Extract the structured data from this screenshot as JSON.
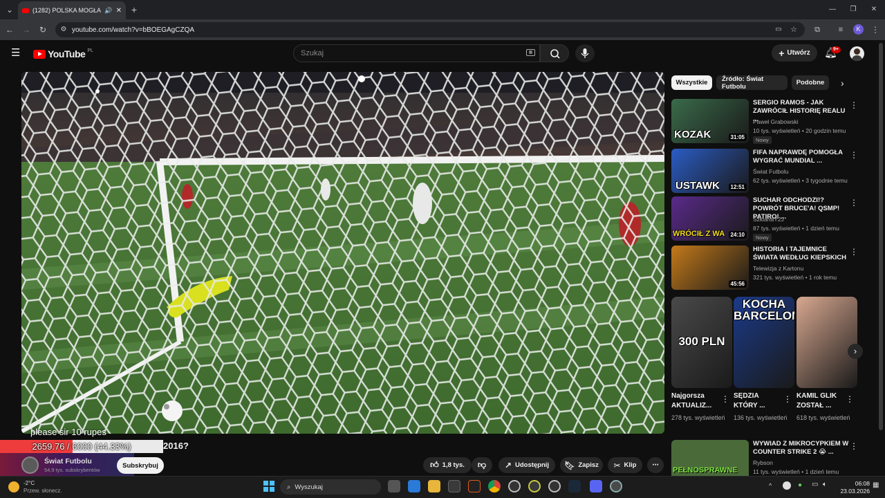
{
  "browser": {
    "tab_title": "(1282) POLSKA MOGŁA WY",
    "url": "youtube.com/watch?v=bBOEGAgCZQA"
  },
  "header": {
    "logo_text": "YouTube",
    "region": "PL",
    "search_placeholder": "Szukaj",
    "create_label": "Utwórz",
    "notif_count": "9+",
    "profile_initial": "K"
  },
  "player": {
    "overlay_text": "please sir 10 rupes",
    "progress_text": "2659.76 / 6000 (44.33%)",
    "progress_fraction": 0.4433,
    "title_fragment": "2016?"
  },
  "channel": {
    "name": "Świat Futbolu",
    "subs": "54,9 tys. subskrybentów",
    "subscribe_label": "Subskrybuj"
  },
  "actions": {
    "likes": "1,8 tys.",
    "share": "Udostępnij",
    "save": "Zapisz",
    "clip": "Klip"
  },
  "chips": [
    "Wszystkie",
    "Źródło: Świat Futbolu",
    "Podobne"
  ],
  "recommendations": [
    {
      "title": "SERGIO RAMOS - JAK ZAWRÓCIŁ HISTORIĘ REALU ...",
      "thumb_text": "KOZAK",
      "channel": "Paweł Grabowski",
      "meta": "10 tys. wyświetleń • 20 godzin temu",
      "duration": "31:05",
      "badge": "Nowy",
      "thumb_color": "#3a6b4a"
    },
    {
      "title": "FIFA NAPRAWDĘ POMOGŁA WYGRAĆ MUNDIAL ...",
      "thumb_text": "USTAWK",
      "channel": "Świat Futbolu",
      "meta": "62 tys. wyświetleń • 3 tygodnie temu",
      "duration": "12:51",
      "badge": "",
      "thumb_color": "#2b5cc4"
    },
    {
      "title": "SUCHAR ODCHODZI!? POWRÓT BRUCE'A! QSMP! PATIRO! ...",
      "thumb_text": "WRÓCIŁ Z WA",
      "channel": "SzklanaY2J",
      "meta": "87 tys. wyświetleń • 1 dzień temu",
      "duration": "24:10",
      "badge": "Nowy",
      "thumb_color": "#5a2a8a"
    },
    {
      "title": "HISTORIA I TAJEMNICE ŚWIATA WEDŁUG KIEPSKICH",
      "thumb_text": "",
      "channel": "Telewizja z Kartonu",
      "meta": "321 tys. wyświetleń • 1 rok temu",
      "duration": "45:56",
      "badge": "",
      "thumb_color": "#c47a1a"
    }
  ],
  "shorts": [
    {
      "title": "Najgorsza AKTUALIZ...",
      "views": "278 tys. wyświetleń",
      "thumb_text": "300 PLN",
      "thumb_color": "#4a4a4a"
    },
    {
      "title": "SĘDZIA KTÓRY ...",
      "views": "136 tys. wyświetleń",
      "thumb_text": "KOCHA BARCELONE",
      "thumb_color": "#1b3a8a"
    },
    {
      "title": "KAMIL GLIK ZOSTAŁ ...",
      "views": "618 tys. wyświetleń",
      "thumb_text": "",
      "thumb_color": "#d8a890"
    }
  ],
  "rec_bottom": {
    "title": "WYWIAD Z MIKROCYPKIEM W COUNTER STRIKE 2 😭 ...",
    "channel": "Rybson",
    "meta": "11 tys. wyświetleń • 1 dzień temu",
    "thumb_text": "PEŁNOSPRAWNE"
  },
  "taskbar": {
    "weather_temp": "-2°C",
    "weather_desc": "Przew. słonecz.",
    "search_label": "Wyszukaj",
    "time": "06:08",
    "date": "23.03.2026"
  },
  "colors": {
    "youtube_red": "#ff0000",
    "background": "#0f0f0f",
    "chip_active": "#f1f1f1"
  }
}
